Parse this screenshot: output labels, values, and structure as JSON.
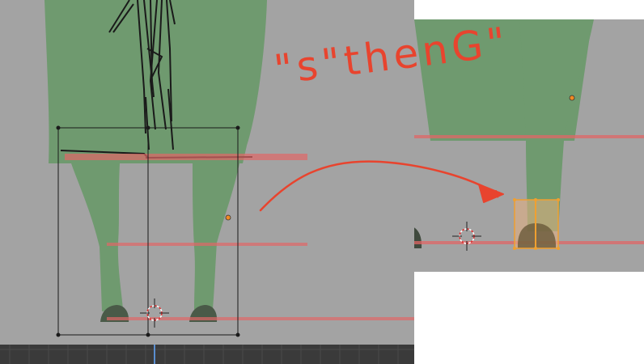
{
  "annotation": {
    "text": "\"s\"thenG\"",
    "color": "#e8442e"
  },
  "colors": {
    "viewport_bg": "#a3a3a3",
    "character_fill": "#6f9a6f",
    "reference_line": "#e06666",
    "selection_box": "#1a1a1a",
    "selected_bone": "#f0a030",
    "origin_dot": "#f08a24",
    "timeline_bg": "#3a3a3a",
    "playhead": "#5a8ed0"
  },
  "icons": {
    "cursor": "3d-cursor-icon",
    "origin": "object-origin-icon"
  }
}
